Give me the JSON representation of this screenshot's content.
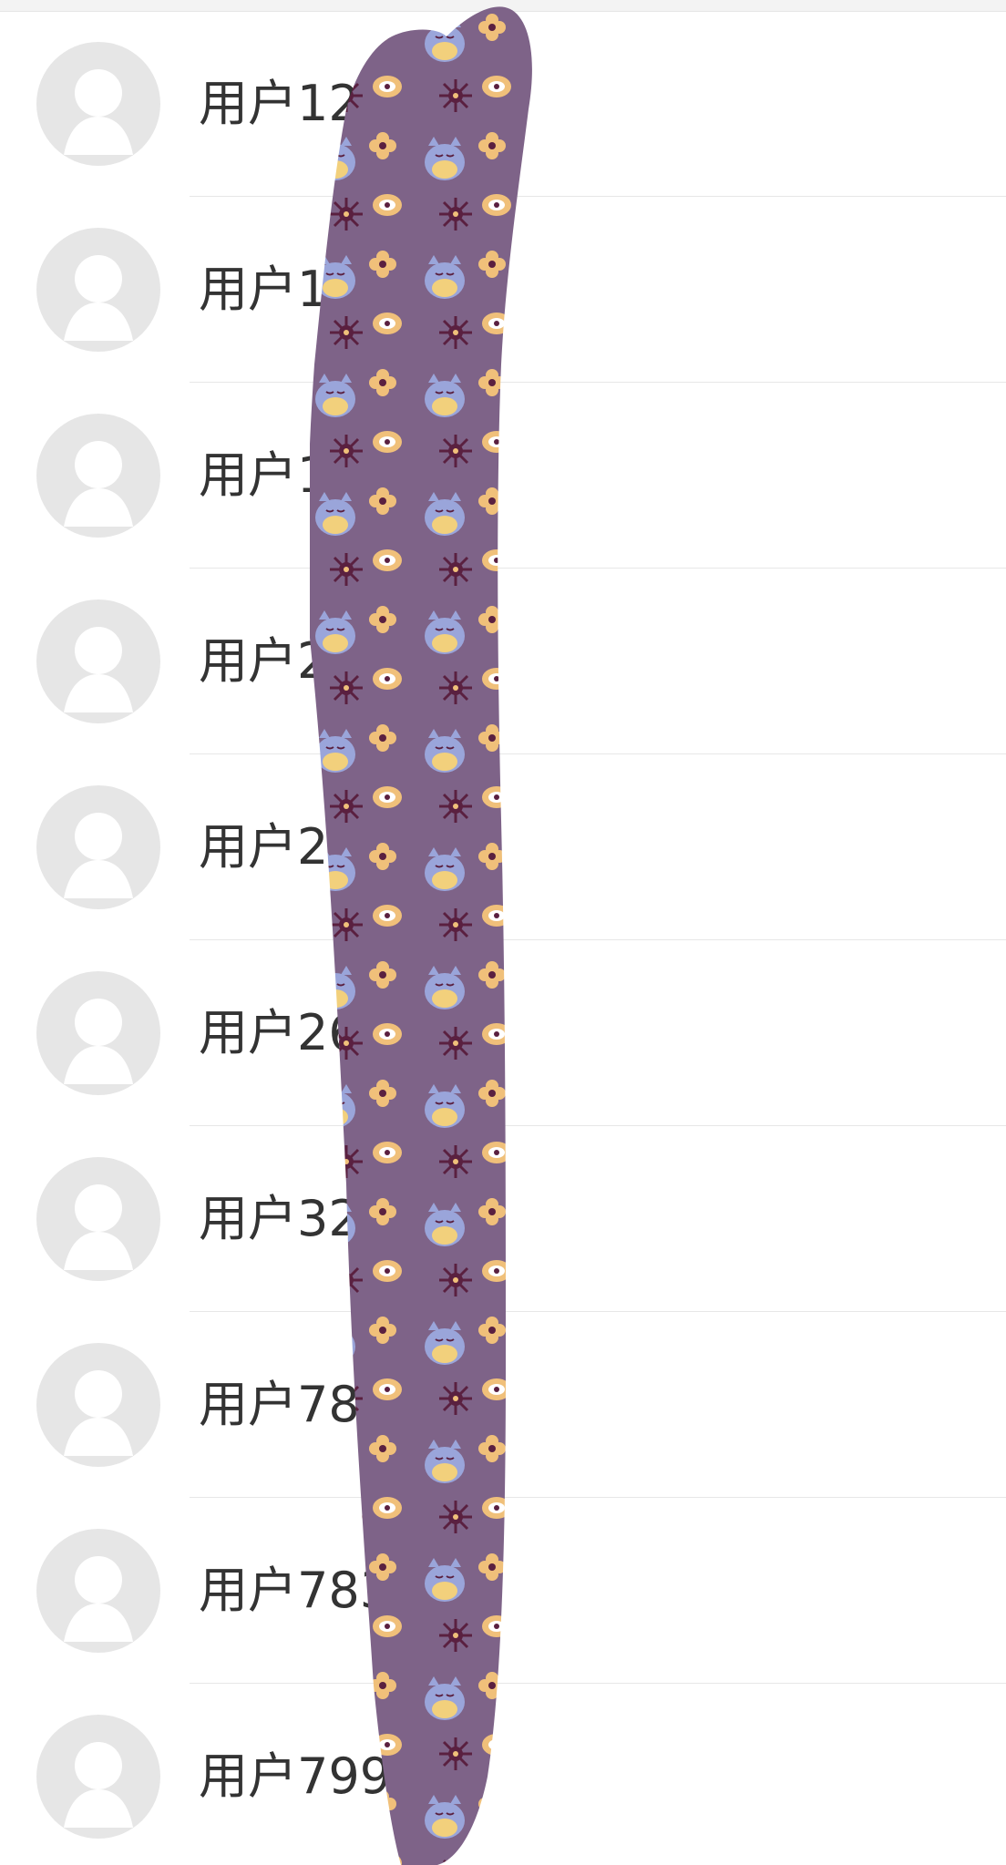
{
  "colors": {
    "background": "#ffffff",
    "top_strip": "#f3f3f3",
    "divider": "#e7e7e7",
    "avatar_fill": "#e6e6e6",
    "text": "#333333",
    "overlay_base": "#7e6388",
    "overlay_owl": "#9aa5da",
    "overlay_owl_belly": "#f2d07c",
    "overlay_flower": "#f0c07a",
    "overlay_dark": "#5a2040"
  },
  "users": [
    {
      "name": "用户1256  8",
      "avatar_icon": "default-avatar-icon"
    },
    {
      "name": "用户167",
      "avatar_icon": "default-avatar-icon"
    },
    {
      "name": "用户18",
      "avatar_icon": "default-avatar-icon"
    },
    {
      "name": "用户2  6",
      "avatar_icon": "default-avatar-icon"
    },
    {
      "name": "用户2  0",
      "avatar_icon": "default-avatar-icon"
    },
    {
      "name": "用户26",
      "avatar_icon": "default-avatar-icon"
    },
    {
      "name": "用户32",
      "avatar_icon": "default-avatar-icon"
    },
    {
      "name": "用户783",
      "avatar_icon": "default-avatar-icon"
    },
    {
      "name": "用户7835",
      "avatar_icon": "default-avatar-icon"
    },
    {
      "name": "用户7993",
      "avatar_icon": "default-avatar-icon"
    }
  ]
}
